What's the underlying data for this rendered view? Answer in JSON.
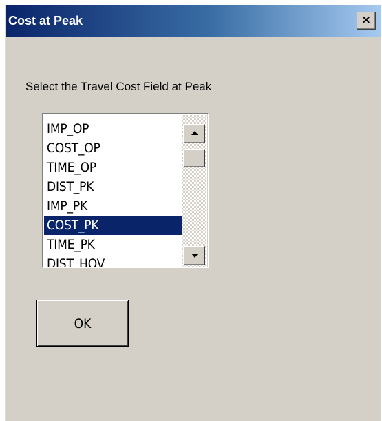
{
  "window": {
    "title": "Cost at Peak",
    "close_label": "×"
  },
  "prompt": "Select the Travel Cost Field at Peak",
  "listbox": {
    "items": [
      {
        "label": "IMP_OP",
        "selected": false
      },
      {
        "label": "COST_OP",
        "selected": false
      },
      {
        "label": "TIME_OP",
        "selected": false
      },
      {
        "label": "DIST_PK",
        "selected": false
      },
      {
        "label": "IMP_PK",
        "selected": false
      },
      {
        "label": "COST_PK",
        "selected": true
      },
      {
        "label": "TIME_PK",
        "selected": false
      },
      {
        "label": "DIST_HOV",
        "selected": false
      }
    ]
  },
  "ok_button": {
    "label": "OK"
  },
  "colors": {
    "selection": "#0a246a",
    "dialog_face": "#d4d0c8"
  }
}
